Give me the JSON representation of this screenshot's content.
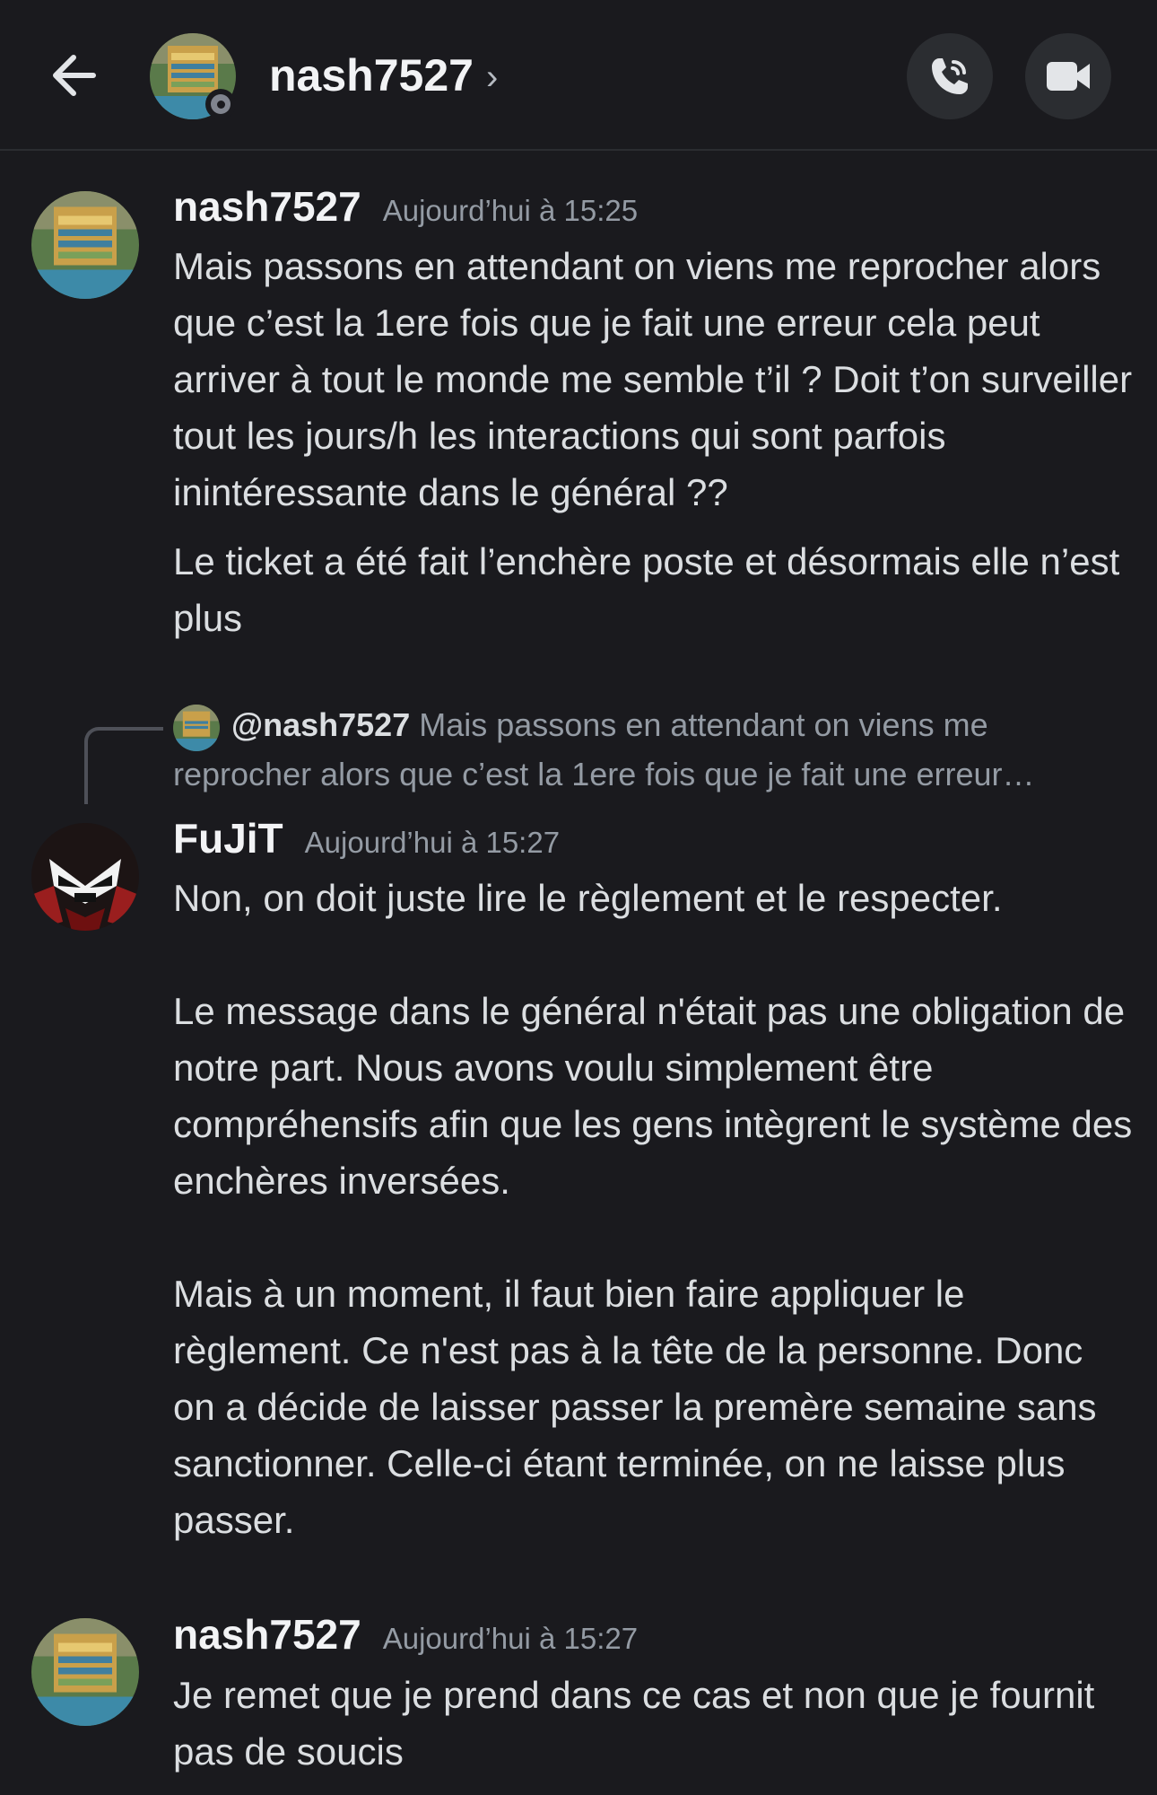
{
  "header": {
    "title": "nash7527",
    "chevron": "›",
    "back_icon": "arrow-left-icon",
    "call_icon": "phone-icon",
    "video_icon": "video-camera-icon"
  },
  "messages": [
    {
      "author": "nash7527",
      "timestamp": "Aujourd’hui à 15:25",
      "paragraphs": [
        "Mais passons en attendant on viens me reprocher alors que c’est la 1ere fois que je fait une erreur cela peut arriver à tout le monde me semble t’il ? Doit t’on surveiller tout les jours/h les interactions qui sont parfois inintéressante dans le général ??",
        "Le ticket a été fait l’enchère poste et désormais elle n’est plus"
      ]
    },
    {
      "reply": {
        "author": "@nash7527",
        "preview": "Mais passons en attendant on viens me reprocher alors que c’est la 1ere fois que je fait une erreur…"
      },
      "author": "FuJiT",
      "timestamp": "Aujourd’hui à 15:27",
      "paragraphs": [
        "Non, on doit juste lire le règlement et le respecter.\n\nLe message dans le général n'était pas une obligation de notre part. Nous avons voulu simplement être compréhensifs afin que les gens intègrent le système des enchères inversées.\n\nMais à un moment, il faut bien faire appliquer le règlement. Ce n'est pas à la tête de la personne. Donc on a décide de laisser passer la premère semaine sans sanctionner. Celle-ci étant terminée, on ne laisse plus passer."
      ]
    },
    {
      "author": "nash7527",
      "timestamp": "Aujourd’hui à 15:27",
      "paragraphs": [
        "Je remet que je prend dans ce cas et non que je fournit pas de soucis"
      ]
    }
  ],
  "colors": {
    "background": "#1a1a1e",
    "text": "#dbdee1",
    "muted": "#949ba4",
    "button_bg": "#2b2d31"
  }
}
